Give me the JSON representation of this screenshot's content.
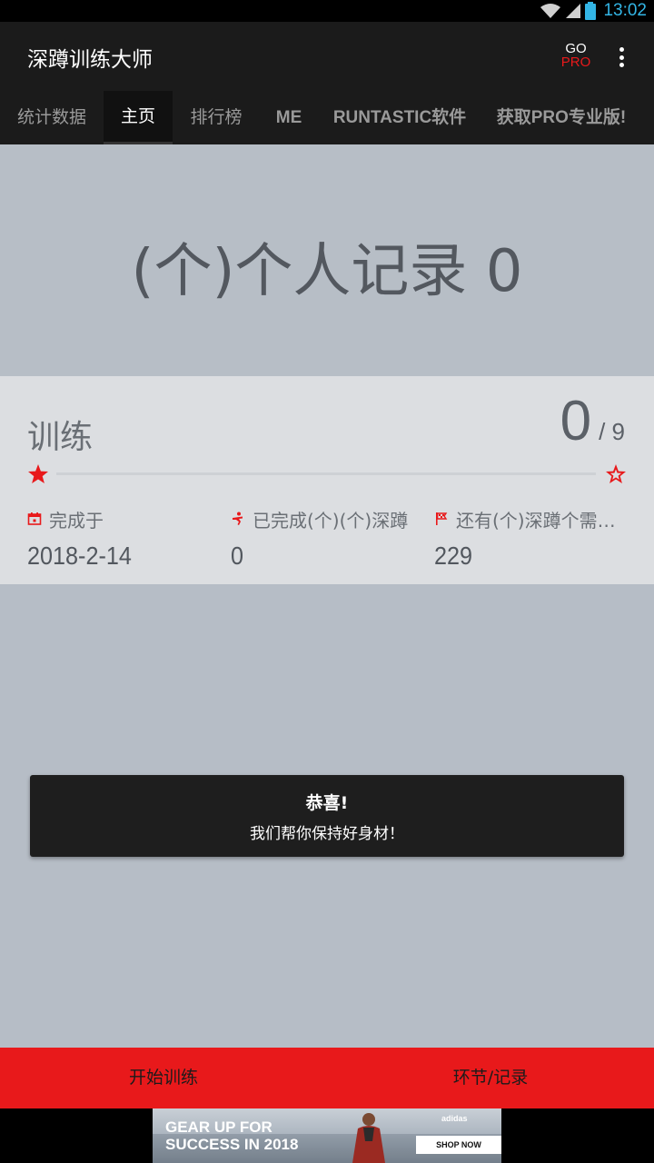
{
  "status_bar": {
    "time": "13:02",
    "icons": [
      "wifi-icon",
      "signal-icon",
      "battery-icon"
    ]
  },
  "app_bar": {
    "title": "深蹲训练大师",
    "go_label": "GO",
    "pro_label": "PRO",
    "menu_icon": "more-vert-icon"
  },
  "tabs": [
    {
      "label": "统计数据",
      "active": false
    },
    {
      "label": "主页",
      "active": true
    },
    {
      "label": "排行榜",
      "active": false
    },
    {
      "label": "ME",
      "active": false
    },
    {
      "label": "RUNTASTIC软件",
      "active": false
    },
    {
      "label": "获取PRO专业版!",
      "active": false
    }
  ],
  "hero": {
    "record_text": "(个)个人记录 0"
  },
  "training": {
    "label": "训练",
    "completed": "0",
    "total": "/ 9",
    "progress_fraction": 0,
    "stats": [
      {
        "icon": "calendar-icon",
        "label": "完成于",
        "value": "2018-2-14"
      },
      {
        "icon": "squat-figure-icon",
        "label": "已完成(个)(个)深蹲",
        "value": "0"
      },
      {
        "icon": "flag-icon",
        "label": "还有(个)深蹲个需要完成",
        "value": "229"
      }
    ]
  },
  "toast": {
    "title": "恭喜!",
    "message": "我们帮你保持好身材！"
  },
  "actions": {
    "start": "开始训练",
    "records": "环节/记录"
  },
  "ad": {
    "headline_line1": "GEAR UP FOR",
    "headline_line2": "SUCCESS IN 2018",
    "brand": "adidas",
    "cta": "SHOP NOW"
  },
  "colors": {
    "accent": "#e8191b",
    "appbar": "#1b1b1b",
    "background": "#b6bdc6",
    "card": "#dcdee1"
  }
}
